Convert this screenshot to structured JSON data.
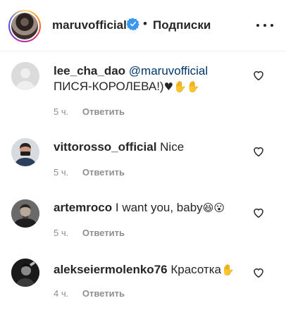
{
  "header": {
    "username": "maruvofficial",
    "separator": "•",
    "follow_label": "Подписки"
  },
  "comments": [
    {
      "username": "lee_cha_dao",
      "mention": "@maruvofficial",
      "text": "ПИСЯ-КОРОЛЕВА!)",
      "emoji": "♥✋✋",
      "time": "5 ч.",
      "reply": "Ответить"
    },
    {
      "username": "vittorosso_official",
      "mention": "",
      "text": "Nice",
      "emoji": "",
      "time": "5 ч.",
      "reply": "Ответить"
    },
    {
      "username": "artemroco",
      "mention": "",
      "text": "I want you, baby",
      "emoji": "😆😮",
      "time": "5 ч.",
      "reply": "Ответить"
    },
    {
      "username": "alekseiermolenko76",
      "mention": "",
      "text": "Красотка",
      "emoji": "✋",
      "time": "4 ч.",
      "reply": "Ответить"
    }
  ],
  "colors": {
    "text": "#262626",
    "muted": "#8e8e8e",
    "mention": "#00376b",
    "verified": "#3897f0",
    "divider": "#efefef"
  }
}
